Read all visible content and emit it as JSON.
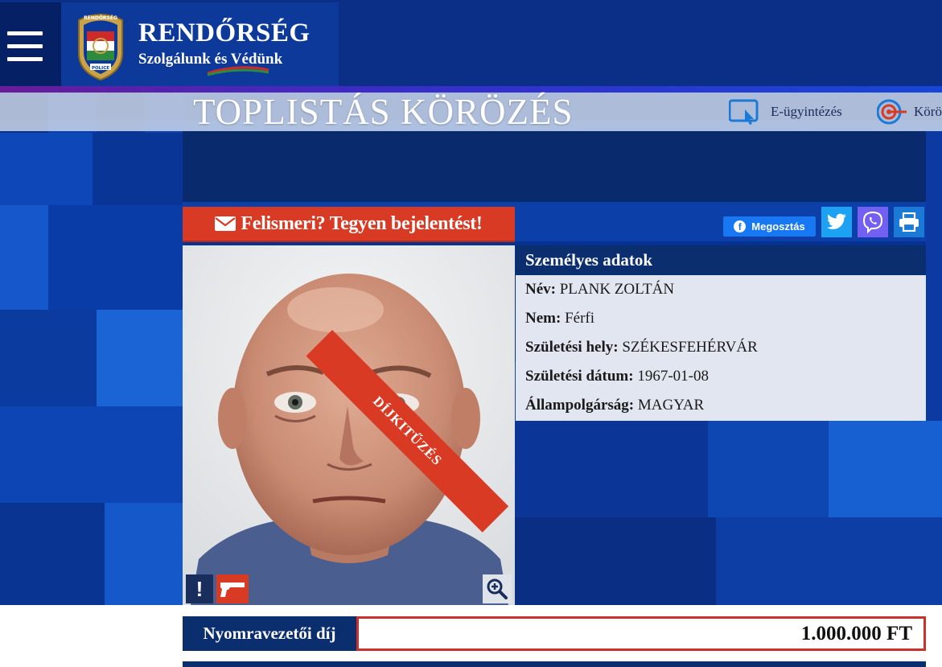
{
  "header": {
    "brand_title": "RENDŐRSÉG",
    "brand_slogan": "Szolgálunk és Védünk",
    "badge_top": "RENDŐRSÉG",
    "badge_bottom": "POLICE"
  },
  "page_title": "TOPLISTÁS KÖRÖZÉS",
  "top_links": [
    {
      "label": "E-ügyintézés",
      "icon": "tablet-touch-icon"
    },
    {
      "label": "Körö",
      "icon": "target-icon"
    }
  ],
  "actions": {
    "report_label": "Felismeri? Tegyen bejelentést!",
    "share_label": "Megosztás"
  },
  "ribbon": "DÍJKITŰZÉS",
  "personal": {
    "heading": "Személyes adatok",
    "rows": [
      {
        "label": "Név:",
        "value": "PLANK ZOLTÁN"
      },
      {
        "label": "Nem:",
        "value": "Férfi"
      },
      {
        "label": "Születési hely:",
        "value": "SZÉKESFEHÉRVÁR"
      },
      {
        "label": "Születési dátum:",
        "value": "1967-01-08"
      },
      {
        "label": "Állampolgárság:",
        "value": "MAGYAR"
      }
    ]
  },
  "reward": {
    "label": "Nyomravezetői díj",
    "value": "1.000.000 FT"
  },
  "colors": {
    "navy": "#0b2f6e",
    "red": "#d93a24",
    "facebook": "#1877f2",
    "twitter": "#1da1f2",
    "viber": "#7360f2",
    "print": "#1a7ad6"
  }
}
